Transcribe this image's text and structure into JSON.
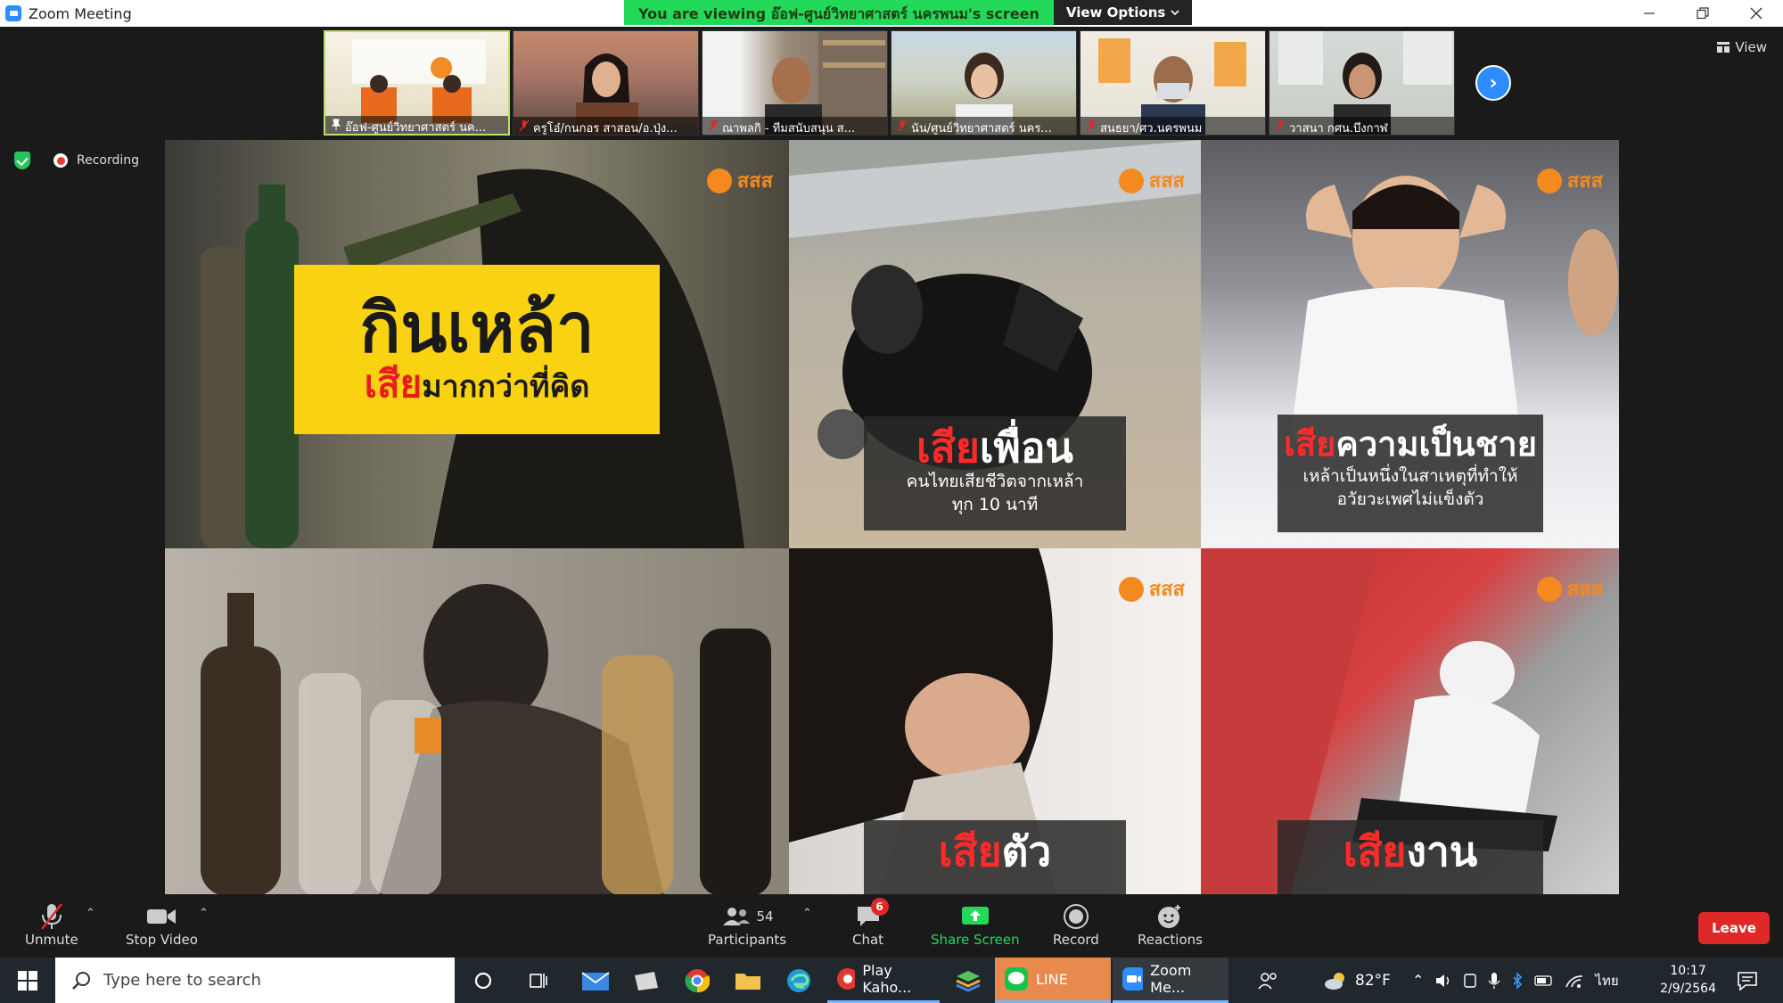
{
  "window": {
    "title": "Zoom Meeting",
    "banner_text": "You are viewing อ๊อฟ-ศูนย์วิทยาศาสตร์ นครพนม's screen",
    "view_options_label": "View Options",
    "view_label": "View",
    "recording_label": "Recording"
  },
  "thumbnails": [
    {
      "name": "อ๊อฟ-ศูนย์วิทยาศาสตร์ นค...",
      "active": true
    },
    {
      "name": "ครูโอ๋/กนกอร สาสอน/อ.ปุ่ง..."
    },
    {
      "name": "ณาพลกิ - ทีมสนับสนุน ส..."
    },
    {
      "name": "นัน/ศูนย์วิทยาศาสตร์ นคร..."
    },
    {
      "name": "สนธยา/ศว.นครพนม"
    },
    {
      "name": "วาสนา กศน.บึงกาฬ"
    }
  ],
  "slide": {
    "brand_text": "สสส",
    "hero_title": "กินเหล้า",
    "hero_sub_red": "เสีย",
    "hero_sub_black": "มากกว่าที่คิด",
    "panel_friends": {
      "red": "เสีย",
      "white": "เพื่อน",
      "sub_line1": "คนไทยเสียชีวิตจากเหล้า",
      "sub_line2": "ทุก 10 นาที"
    },
    "panel_manhood": {
      "red": "เสีย",
      "white": "ความเป็นชาย",
      "sub_line1": "เหล้าเป็นหนึ่งในสาเหตุที่ทำให้",
      "sub_line2": "อวัยวะเพศไม่แข็งตัว"
    },
    "panel_self": {
      "red": "เสีย",
      "white": "ตัว"
    },
    "panel_work": {
      "red": "เสีย",
      "white": "งาน"
    }
  },
  "toolbar": {
    "unmute": "Unmute",
    "stop_video": "Stop Video",
    "participants": "Participants",
    "participants_count": "54",
    "chat": "Chat",
    "chat_badge": "6",
    "share_screen": "Share Screen",
    "record": "Record",
    "reactions": "Reactions",
    "leave": "Leave"
  },
  "taskbar": {
    "search_placeholder": "Type here to search",
    "app_kahoot": "Play Kaho...",
    "app_line": "LINE",
    "app_zoom": "Zoom Me...",
    "temperature": "82°F",
    "language": "ไทย",
    "time": "10:17",
    "date": "2/9/2564"
  },
  "colors": {
    "zoom_blue": "#2d8cff",
    "banner_green": "#23d959",
    "leave_red": "#e02828",
    "share_green": "#23d959",
    "slide_yellow": "#f9d211",
    "slide_red": "#ff2a2a"
  }
}
